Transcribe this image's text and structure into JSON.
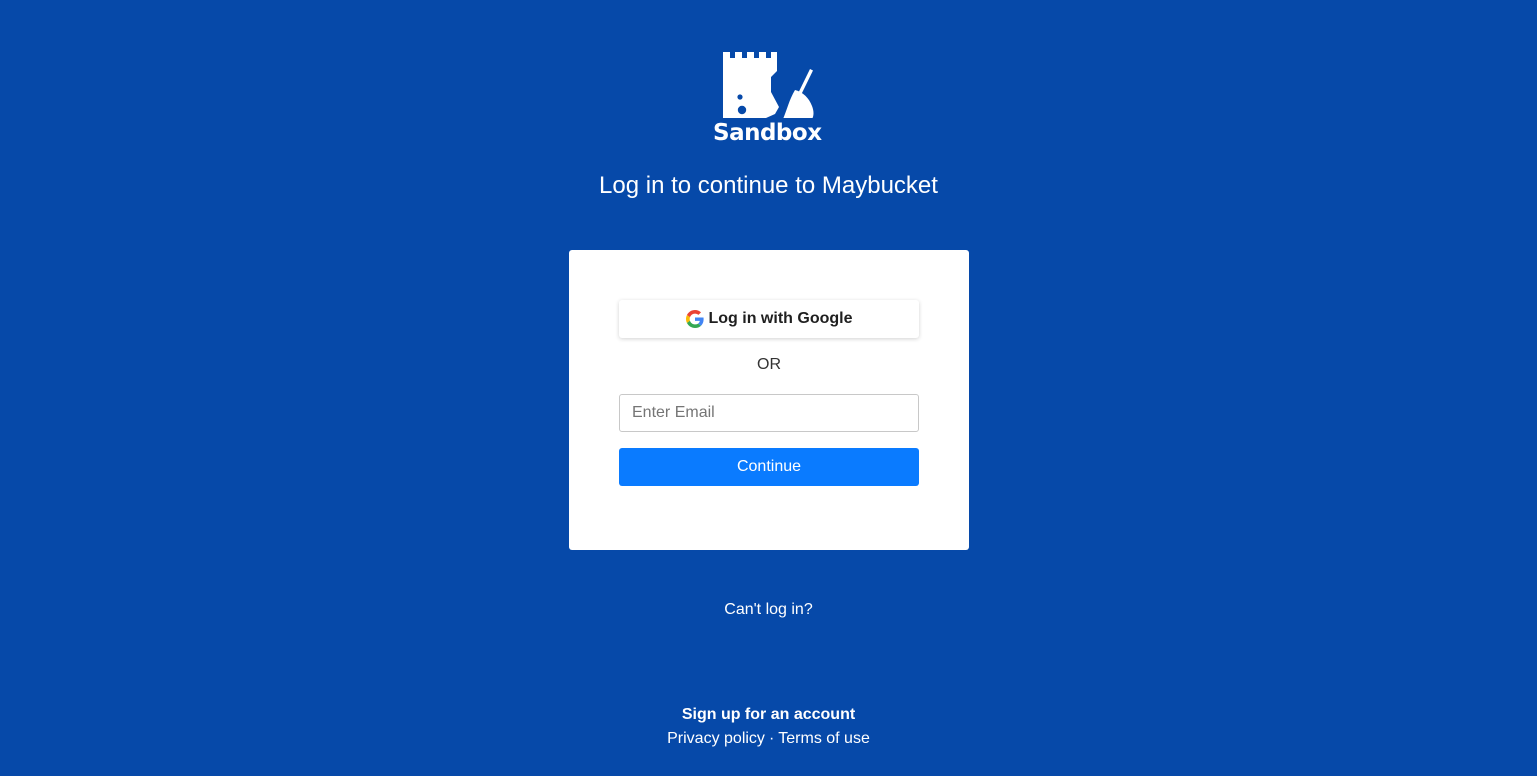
{
  "brand": {
    "logo_icon": "castle-broom-icon",
    "name": "Sandbox"
  },
  "page": {
    "title": "Log in to continue to Maybucket"
  },
  "login_card": {
    "google_button_label": "Log in with Google",
    "google_icon": "google-g-icon",
    "divider_text": "OR",
    "email_placeholder": "Enter Email",
    "email_value": "",
    "continue_label": "Continue"
  },
  "links": {
    "cant_login": "Can't log in?",
    "signup": "Sign up for an account",
    "privacy": "Privacy policy",
    "separator": "·",
    "terms": "Terms of use"
  },
  "colors": {
    "background": "#0649a9",
    "primary_button": "#0a7bff",
    "card": "#ffffff"
  }
}
